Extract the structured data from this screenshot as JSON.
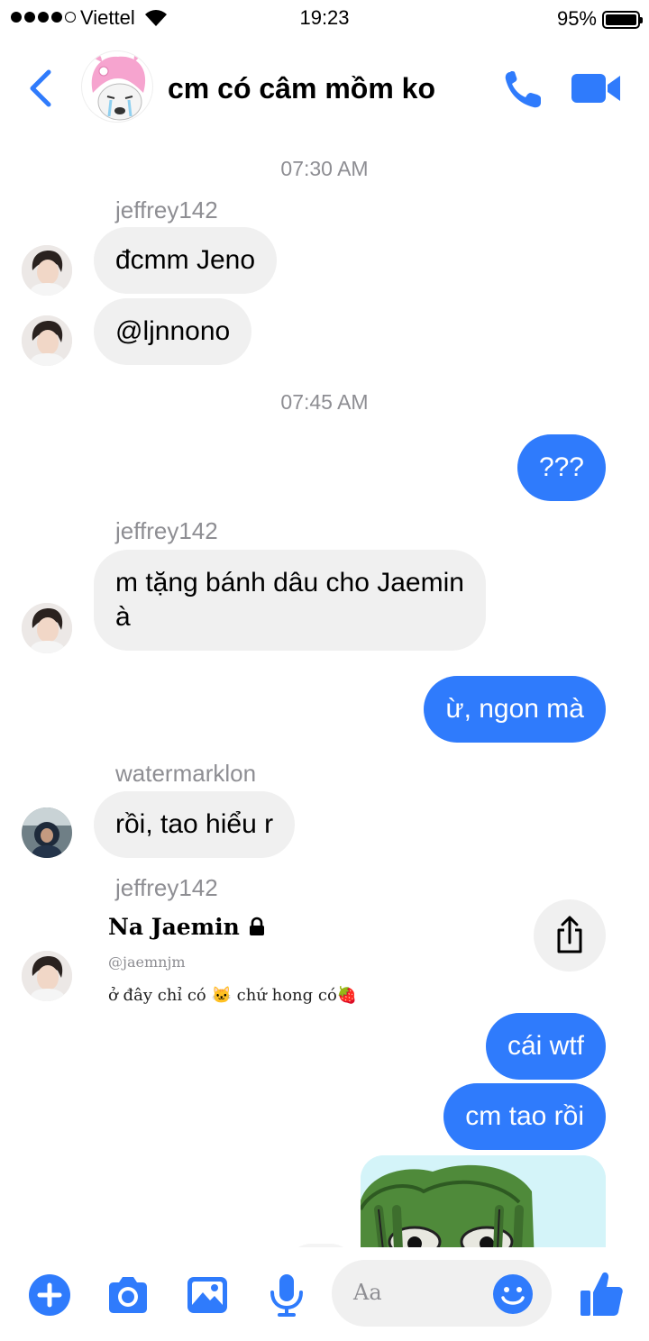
{
  "status_bar": {
    "carrier": "Viettel",
    "time": "19:23",
    "battery": "95%"
  },
  "header": {
    "title": "cm có câm mồm ko",
    "icons": {
      "back": "chevron-left-icon",
      "call": "phone-icon",
      "video": "video-camera-icon"
    }
  },
  "colors": {
    "accent": "#2f7bfc",
    "incoming_bubble": "#f0f0f0",
    "meta_text": "#8e8e93"
  },
  "messages": {
    "ts1": "07:30 AM",
    "sender1": "jeffrey142",
    "m1": "đcmm Jeno",
    "m2": "@ljnnono",
    "ts2": "07:45 AM",
    "m3": "???",
    "sender2": "jeffrey142",
    "m4_line1": "m tặng bánh dâu cho Jaemin",
    "m4_line2": "à",
    "m5": "ừ, ngon mà",
    "sender3": "watermarklon",
    "m6": "rồi, tao hiểu r",
    "sender4": "jeffrey142",
    "shared_post": {
      "name": "Na Jaemin",
      "handle": "@jaemnjm",
      "caption": "ở đây chỉ có 🐱 chứ hong có🍓"
    },
    "m7": "cái wtf",
    "m8": "cm tao rồi"
  },
  "composer": {
    "placeholder": "Aa",
    "icons": [
      "plus-icon",
      "camera-icon",
      "image-icon",
      "microphone-icon",
      "smiley-icon",
      "thumbs-up-icon"
    ]
  }
}
